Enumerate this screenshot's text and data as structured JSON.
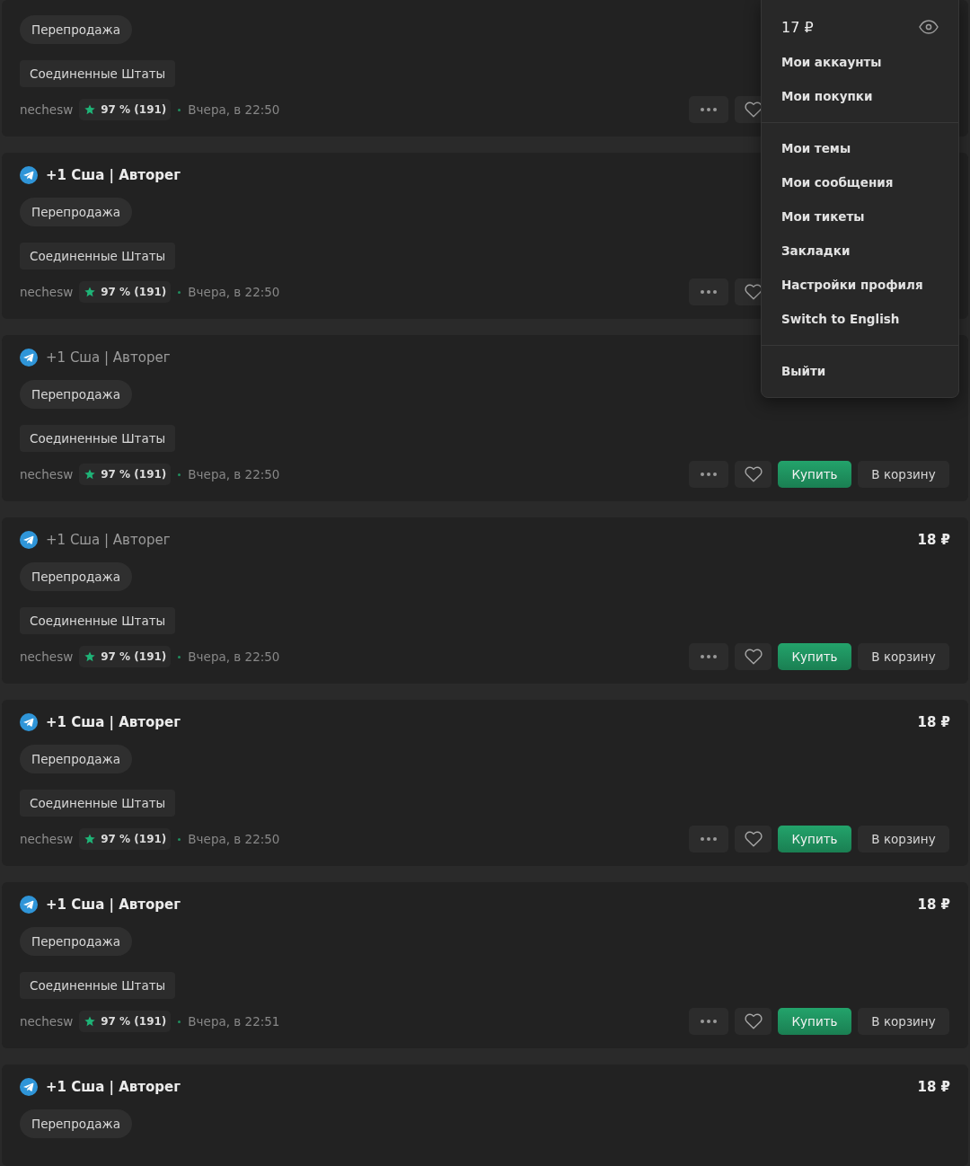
{
  "listings": [
    {
      "tags": [
        {
          "kind": "category",
          "text": "Перепродажа"
        },
        {
          "kind": "country",
          "text": "Соединенные Штаты"
        }
      ],
      "seller": "nechesw",
      "rating": "97 % (191)",
      "time": "Вчера, в 22:50",
      "actions": {
        "favorited": false
      }
    },
    {
      "title": "+1 Сша | Авторег",
      "visited": false,
      "tags": [
        {
          "kind": "category",
          "text": "Перепродажа"
        },
        {
          "kind": "country",
          "text": "Соединенные Штаты"
        }
      ],
      "seller": "nechesw",
      "rating": "97 % (191)",
      "time": "Вчера, в 22:50",
      "actions": {
        "favorited": false
      }
    },
    {
      "title": "+1 Сша | Авторег",
      "visited": true,
      "tags": [
        {
          "kind": "category",
          "text": "Перепродажа"
        },
        {
          "kind": "country",
          "text": "Соединенные Штаты"
        }
      ],
      "seller": "nechesw",
      "rating": "97 % (191)",
      "time": "Вчера, в 22:50",
      "actions": {
        "favorited": false,
        "buy": "Купить",
        "cart": "В корзину"
      }
    },
    {
      "title": "+1 Сша | Авторег",
      "visited": true,
      "price": "18 ₽",
      "tags": [
        {
          "kind": "category",
          "text": "Перепродажа"
        },
        {
          "kind": "country",
          "text": "Соединенные Штаты"
        }
      ],
      "seller": "nechesw",
      "rating": "97 % (191)",
      "time": "Вчера, в 22:50",
      "actions": {
        "favorited": false,
        "buy": "Купить",
        "cart": "В корзину"
      }
    },
    {
      "title": "+1 Сша | Авторег",
      "visited": false,
      "price": "18 ₽",
      "tags": [
        {
          "kind": "category",
          "text": "Перепродажа"
        },
        {
          "kind": "country",
          "text": "Соединенные Штаты"
        }
      ],
      "seller": "nechesw",
      "rating": "97 % (191)",
      "time": "Вчера, в 22:50",
      "actions": {
        "favorited": false,
        "buy": "Купить",
        "cart": "В корзину"
      }
    },
    {
      "title": "+1 Сша | Авторег",
      "visited": false,
      "price": "18 ₽",
      "tags": [
        {
          "kind": "category",
          "text": "Перепродажа"
        },
        {
          "kind": "country",
          "text": "Соединенные Штаты"
        }
      ],
      "seller": "nechesw",
      "rating": "97 % (191)",
      "time": "Вчера, в 22:51",
      "actions": {
        "favorited": false,
        "buy": "Купить",
        "cart": "В корзину"
      }
    },
    {
      "title": "+1 Сша | Авторег",
      "visited": false,
      "price": "18 ₽",
      "tags": [
        {
          "kind": "category",
          "text": "Перепродажа"
        }
      ]
    }
  ],
  "account_menu": {
    "balance": "17 ₽",
    "groups": [
      {
        "items": [
          "Мои аккаунты",
          "Мои покупки"
        ]
      },
      {
        "items": [
          "Мои темы",
          "Мои сообщения",
          "Мои тикеты",
          "Закладки",
          "Настройки профиля",
          "Switch to English"
        ]
      },
      {
        "items": [
          "Выйти"
        ]
      }
    ]
  }
}
